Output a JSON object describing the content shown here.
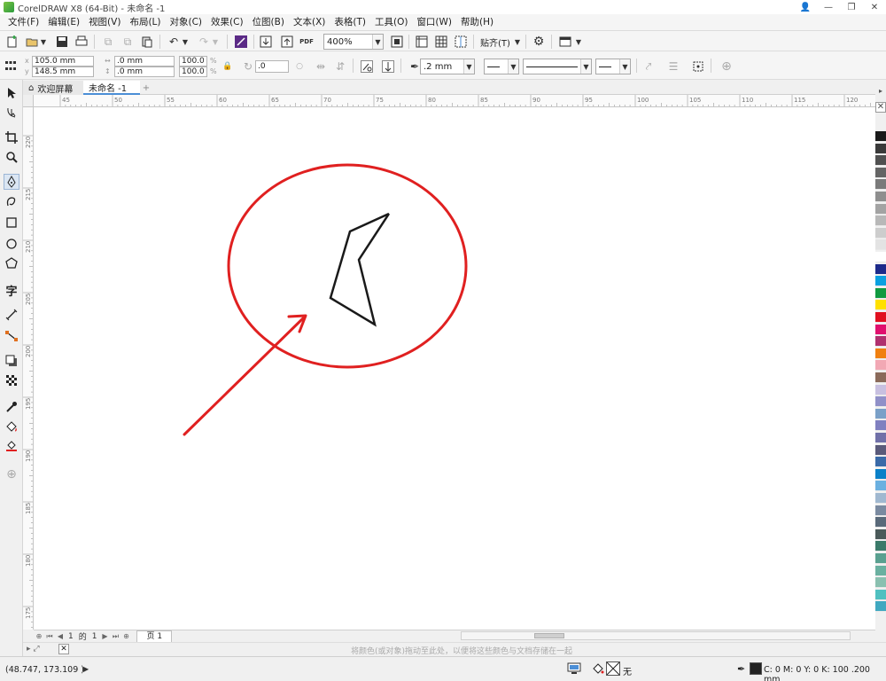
{
  "window": {
    "title": "CorelDRAW X8 (64-Bit) - 未命名 -1",
    "controls": [
      "👤",
      "—",
      "❐",
      "✕"
    ]
  },
  "menu": {
    "items": [
      "文件(F)",
      "编辑(E)",
      "视图(V)",
      "布局(L)",
      "对象(C)",
      "效果(C)",
      "位图(B)",
      "文本(X)",
      "表格(T)",
      "工具(O)",
      "窗口(W)",
      "帮助(H)"
    ]
  },
  "toolbar": {
    "zoom_value": "400%",
    "snap_label": "贴齐(T)",
    "pdf_label": "PDF"
  },
  "propbar": {
    "x_value": "105.0 mm",
    "y_value": "148.5 mm",
    "w_value": ".0 mm",
    "h_value": ".0 mm",
    "scale_x": "100.0",
    "scale_y": "100.0",
    "percent": "%",
    "rotation": ".0",
    "outline_width": ".2 mm"
  },
  "tabs": {
    "welcome": "欢迎屏幕",
    "document": "未命名 -1",
    "add": "+"
  },
  "rulers": {
    "top_labels": [
      "45",
      "50",
      "55",
      "60",
      "65",
      "70",
      "75",
      "80",
      "85",
      "90",
      "95",
      "100",
      "105",
      "110",
      "115",
      "120"
    ],
    "left_labels": [
      "220",
      "215",
      "210",
      "205",
      "200",
      "195",
      "190",
      "185",
      "180",
      "175"
    ]
  },
  "canvas": {
    "ellipse_color": "#e02020",
    "arrow_color": "#e02020",
    "shape_color": "#1a1a1a"
  },
  "palette": {
    "colors": [
      "#1a1a1a",
      "#3a3a3a",
      "#505050",
      "#656565",
      "#7a7a7a",
      "#8e8e8e",
      "#a3a3a3",
      "#b8b8b8",
      "#cdcdcd",
      "#e3e3e3",
      "#ffffff",
      "#1d2a8a",
      "#0aa0e0",
      "#109a40",
      "#ffe000",
      "#e01020",
      "#e0106e",
      "#b0306e",
      "#f08010",
      "#f2a8b4",
      "#8a6a5a",
      "#c8c0e0",
      "#9090c8",
      "#7aa0c8",
      "#8080c0",
      "#7070a8",
      "#5a5a7a",
      "#3a6aa8",
      "#0a80c8",
      "#6ab0e0",
      "#a0b8d0",
      "#7a8aa0",
      "#5a6a7a",
      "#4a5a5a",
      "#3a7a6a",
      "#5aa090",
      "#6ab0a0",
      "#8ac0b0",
      "#50c0c0",
      "#40a8c0"
    ]
  },
  "pagenav": {
    "current": "1",
    "of": "的",
    "total": "1",
    "page_tab": "页 1"
  },
  "hint": {
    "text": "将颜色(或对象)拖动至此处，以便将这些颜色与文档存储在一起"
  },
  "status": {
    "coordinates": "(48.747, 173.109 )",
    "fill": "无",
    "outline": "C: 0 M: 0 Y: 0 K: 100 .200 mm"
  }
}
